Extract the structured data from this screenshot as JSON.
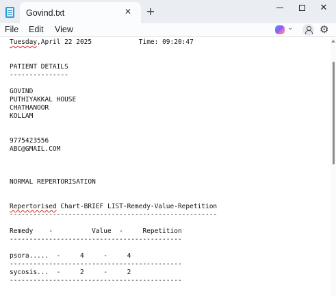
{
  "tab": {
    "title": "Govind.txt",
    "close_glyph": "✕"
  },
  "new_tab_glyph": "+",
  "window_controls": {
    "close_glyph": "✕"
  },
  "menu": {
    "file": "File",
    "edit": "Edit",
    "view": "View"
  },
  "toolbar": {
    "copilot_chevron": "⌄",
    "settings_glyph": "⚙"
  },
  "editor": {
    "header": {
      "day": "Tuesday",
      "rest": ",April 22 2025            Time: 09:20:47"
    },
    "lines": {
      "patient_details": "PATIENT DETAILS",
      "underline_short": "---------------",
      "name": "GOVIND",
      "house": "PUTHIYAKKAL HOUSE",
      "place": "CHATHANOOR",
      "district": "KOLLAM",
      "phone": "9775423556",
      "email": "ABC@GMAIL.COM",
      "normal_rep": "NORMAL REPERTORISATION",
      "underline_long": "-----------------------------------------------------",
      "table_header": "Remedy    -          Value  -     Repetition",
      "sep1": "--------------------------------------------",
      "row1": "psora.....  -     4     -     4",
      "sep2": "--------------------------------------------",
      "row2": "sycosis...  -     2     -     2",
      "sep3": "--------------------------------------------"
    },
    "chart_title": {
      "word": "Repertorised",
      "rest": " Chart-BRIEF LIST-Remedy-Value-Repetition"
    }
  }
}
